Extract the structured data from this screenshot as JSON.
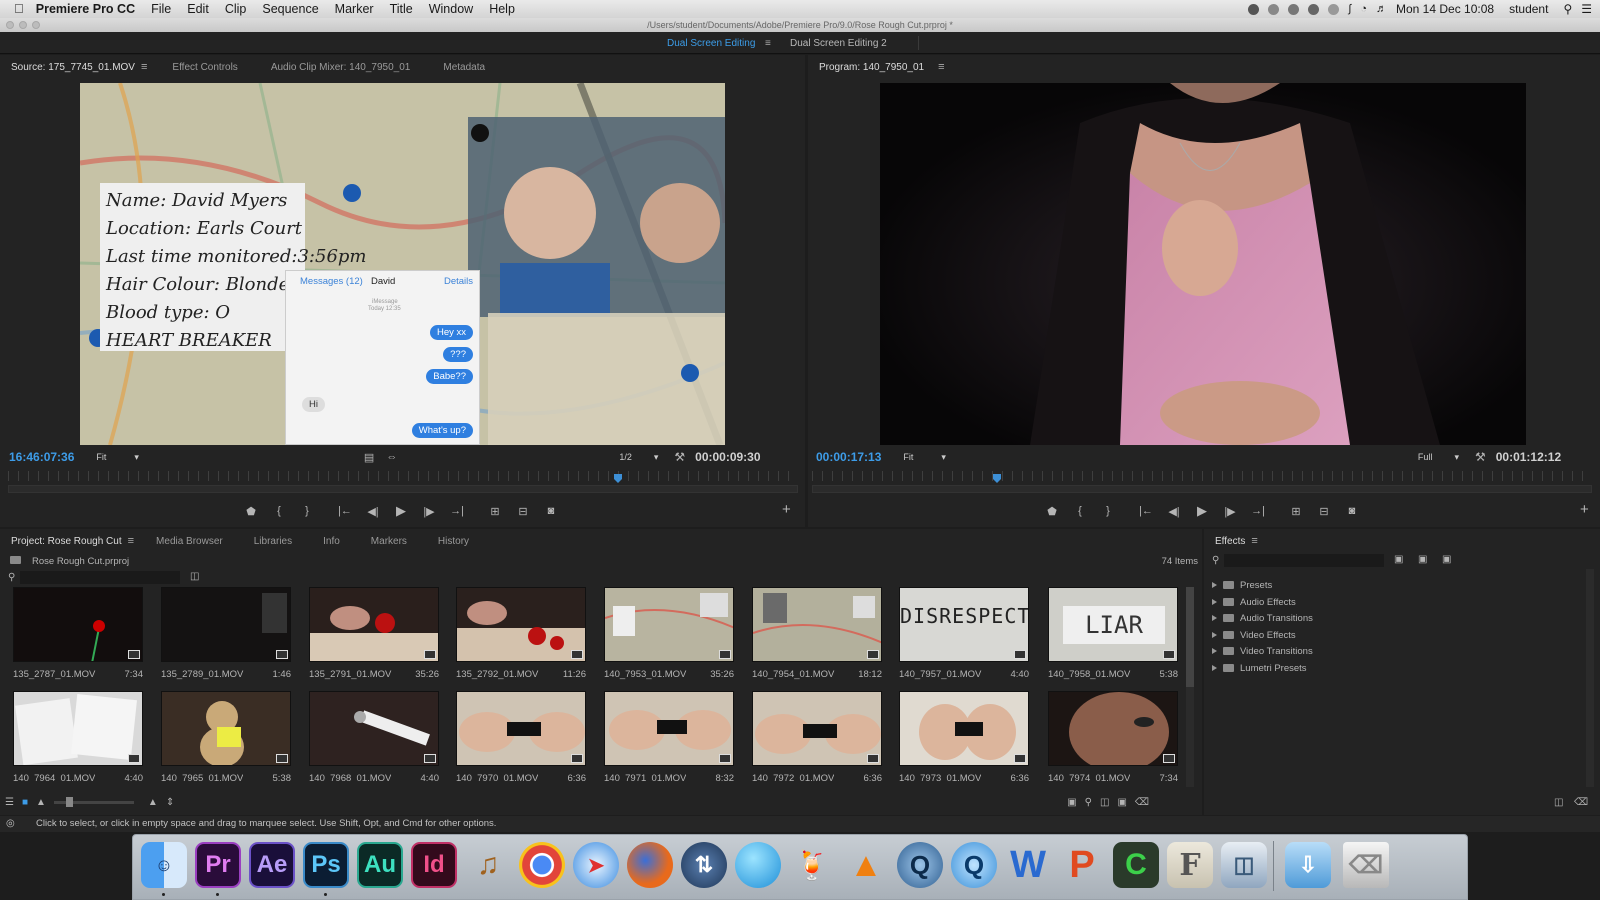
{
  "menubar": {
    "apple": "",
    "app": "Premiere Pro CC",
    "items": [
      "File",
      "Edit",
      "Clip",
      "Sequence",
      "Marker",
      "Title",
      "Window",
      "Help"
    ],
    "clock": "Mon 14 Dec  10:08",
    "user": "student"
  },
  "titlebar": {
    "path": "/Users/student/Documents/Adobe/Premiere Pro/9.0/Rose Rough Cut.prproj *"
  },
  "workspaces": {
    "active": "Dual Screen Editing",
    "menu": "≡",
    "other": "Dual Screen Editing 2"
  },
  "source": {
    "tabs": [
      "Source: 175_7745_01.MOV",
      "Effect Controls",
      "Audio Clip Mixer: 140_7950_01",
      "Metadata"
    ],
    "menu": "≡",
    "timecode": "16:46:07:36",
    "fit": "Fit",
    "resolution": "1/2",
    "duration": "00:00:09:30",
    "overlay": {
      "card_lines": [
        "Name: David Myers",
        "Location: Earls Court",
        "Last time monitored:3:56pm",
        "Hair Colour: Blonde",
        "Blood type: O",
        "HEART BREAKER"
      ],
      "phone": {
        "back": "Messages (12)",
        "contact": "David",
        "details": "Details",
        "meta1": "iMessage",
        "meta2": "Today 12:35",
        "bubbles": [
          "Hey xx",
          "???",
          "Babe??",
          "What's up?"
        ],
        "received": "Hi"
      }
    }
  },
  "program": {
    "tab": "Program: 140_7950_01",
    "menu": "≡",
    "timecode": "00:00:17:13",
    "fit": "Fit",
    "resolution": "Full",
    "duration": "00:01:12:12"
  },
  "controls": {
    "marker": "⬟",
    "in": "{",
    "out": "}",
    "goin": "|←",
    "stepback": "◀|",
    "play": "▶",
    "stepfwd": "|▶",
    "goout": "→|",
    "insert": "⊞",
    "overwrite": "⊟",
    "export": "◙",
    "add": "+"
  },
  "project": {
    "tabs": [
      "Project: Rose Rough Cut",
      "Media Browser",
      "Libraries",
      "Info",
      "Markers",
      "History"
    ],
    "menu": "≡",
    "file": "Rose Rough Cut.prproj",
    "count": "74 Items",
    "clips": [
      {
        "name": "135_2787_01.MOV",
        "dur": "7:34"
      },
      {
        "name": "135_2789_01.MOV",
        "dur": "1:46"
      },
      {
        "name": "135_2791_01.MOV",
        "dur": "35:26"
      },
      {
        "name": "135_2792_01.MOV",
        "dur": "11:26"
      },
      {
        "name": "140_7953_01.MOV",
        "dur": "35:26"
      },
      {
        "name": "140_7954_01.MOV",
        "dur": "18:12"
      },
      {
        "name": "140_7957_01.MOV",
        "dur": "4:40"
      },
      {
        "name": "140_7958_01.MOV",
        "dur": "5:38"
      },
      {
        "name": "140_7964_01.MOV",
        "dur": "4:40"
      },
      {
        "name": "140_7965_01.MOV",
        "dur": "5:38"
      },
      {
        "name": "140_7968_01.MOV",
        "dur": "4:40"
      },
      {
        "name": "140_7970_01.MOV",
        "dur": "6:36"
      },
      {
        "name": "140_7971_01.MOV",
        "dur": "8:32"
      },
      {
        "name": "140_7972_01.MOV",
        "dur": "6:36"
      },
      {
        "name": "140_7973_01.MOV",
        "dur": "6:36"
      },
      {
        "name": "140_7974_01.MOV",
        "dur": "7:34"
      }
    ],
    "thumb_text": {
      "disrespect": "DISRESPECT",
      "liar": "LIAR"
    }
  },
  "effects": {
    "tab": "Effects",
    "menu": "≡",
    "items": [
      "Presets",
      "Audio Effects",
      "Audio Transitions",
      "Video Effects",
      "Video Transitions",
      "Lumetri Presets"
    ]
  },
  "status": "Click to select, or click in empty space and drag to marquee select. Use Shift, Opt, and Cmd for other options.",
  "dock": [
    "Pr",
    "Ae",
    "Ps",
    "Au",
    "Id",
    "W",
    "P",
    "C",
    "F"
  ]
}
